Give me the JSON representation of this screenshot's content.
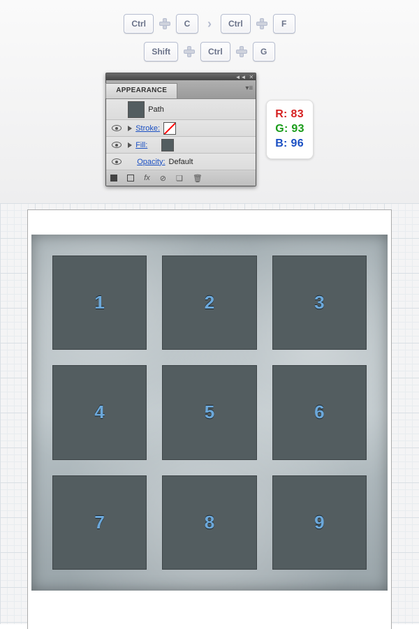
{
  "shortcuts": {
    "row1": {
      "k1": "Ctrl",
      "k2": "C",
      "k3": "Ctrl",
      "k4": "F"
    },
    "row2": {
      "k1": "Shift",
      "k2": "Ctrl",
      "k3": "G"
    }
  },
  "panel": {
    "tab": "APPEARANCE",
    "path_label": "Path",
    "stroke_label": "Stroke:",
    "fill_label": "Fill:",
    "opacity_label": "Opacity:",
    "opacity_value": "Default",
    "fx": "fx"
  },
  "rgb": {
    "r": "R: 83",
    "g": "G: 93",
    "b": "B: 96"
  },
  "cells": [
    "1",
    "2",
    "3",
    "4",
    "5",
    "6",
    "7",
    "8",
    "9"
  ]
}
